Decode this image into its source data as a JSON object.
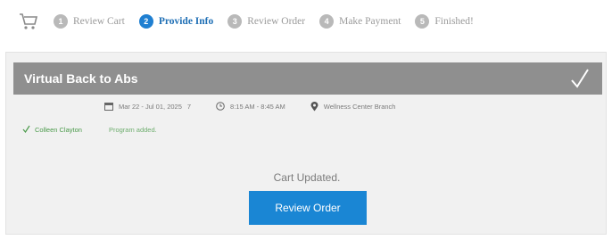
{
  "stepper": {
    "steps": [
      {
        "num": "1",
        "label": "Review Cart"
      },
      {
        "num": "2",
        "label": "Provide Info"
      },
      {
        "num": "3",
        "label": "Review Order"
      },
      {
        "num": "4",
        "label": "Make Payment"
      },
      {
        "num": "5",
        "label": "Finished!"
      }
    ],
    "active_step": 2
  },
  "program": {
    "title": "Virtual Back to Abs",
    "date_range": "Mar 22 - Jul 01, 2025",
    "date_suffix": "7",
    "time_range": "8:15 AM - 8:45 AM",
    "location": "Wellness Center Branch"
  },
  "participant": {
    "name": "Colleen Clayton",
    "status": "Program added."
  },
  "cart": {
    "message": "Cart Updated.",
    "review_button": "Review Order"
  },
  "colors": {
    "accent": "#1a86d4",
    "title_bar": "#8f8f8f",
    "success": "#4a9a4a"
  },
  "icons": [
    "cart-icon",
    "calendar-icon",
    "clock-icon",
    "location-pin-icon",
    "check-icon"
  ]
}
